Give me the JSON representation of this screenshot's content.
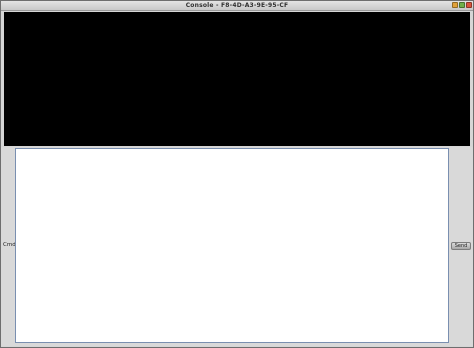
{
  "window": {
    "title": "Console - F8-4D-A3-9E-95-CF"
  },
  "output": {
    "text": ""
  },
  "input": {
    "label": "Cmd",
    "value": "",
    "send_label": "Send"
  },
  "colors": {
    "output_background": "#000000",
    "input_background": "#ffffff",
    "frame": "#d6d6d6",
    "minimize": "#e0a13a",
    "maximize": "#6fb04a",
    "close": "#d9533c"
  },
  "icons": [
    "minimize-icon",
    "maximize-icon",
    "close-icon"
  ]
}
